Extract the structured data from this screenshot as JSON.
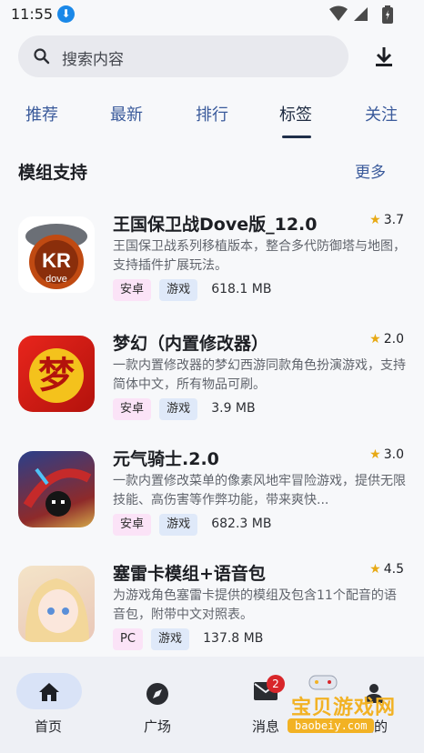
{
  "status_bar": {
    "time": "11:55"
  },
  "search": {
    "placeholder": "搜索内容"
  },
  "tabs": [
    {
      "label": "推荐"
    },
    {
      "label": "最新"
    },
    {
      "label": "排行"
    },
    {
      "label": "标签",
      "active": true
    },
    {
      "label": "关注"
    }
  ],
  "section": {
    "title": "模组支持",
    "more": "更多"
  },
  "apps": [
    {
      "title": "王国保卫战Dove版_12.0",
      "rating": "3.7",
      "desc": "王国保卫战系列移植版本，整合多代防御塔与地图，支持插件扩展玩法。",
      "tags": [
        "安卓",
        "游戏"
      ],
      "size": "618.1 MB",
      "icon_text": "KR",
      "icon_sub": "dove"
    },
    {
      "title": "梦幻（内置修改器）",
      "rating": "2.0",
      "desc": "一款内置修改器的梦幻西游同款角色扮演游戏，支持简体中文，所有物品可刷。",
      "tags": [
        "安卓",
        "游戏"
      ],
      "size": "3.9 MB",
      "icon_text": "梦"
    },
    {
      "title": "元气骑士.2.0",
      "rating": "3.0",
      "desc": "一款内置修改菜单的像素风地牢冒险游戏，提供无限技能、高伤害等作弊功能，带来爽快...",
      "tags": [
        "安卓",
        "游戏"
      ],
      "size": "682.3 MB"
    },
    {
      "title": "塞雷卡模组+语音包",
      "rating": "4.5",
      "desc": "为游戏角色塞雷卡提供的模组及包含11个配音的语音包，附带中文对照表。",
      "tags": [
        "PC",
        "游戏"
      ],
      "size": "137.8 MB"
    }
  ],
  "bottom_nav": [
    {
      "label": "首页",
      "icon": "home-icon",
      "active": true
    },
    {
      "label": "广场",
      "icon": "compass-icon"
    },
    {
      "label": "消息",
      "icon": "mail-icon",
      "badge": "2"
    },
    {
      "label": "我的",
      "icon": "person-icon"
    }
  ],
  "watermark": {
    "text": "宝贝游戏网",
    "url": "baobeiy.com"
  },
  "colors": {
    "accent": "#3a5a9b",
    "star": "#e7a914",
    "tag_pink": "#fbe3f7",
    "tag_blue": "#dfe9f9",
    "nav_bg": "#eef0f5"
  }
}
